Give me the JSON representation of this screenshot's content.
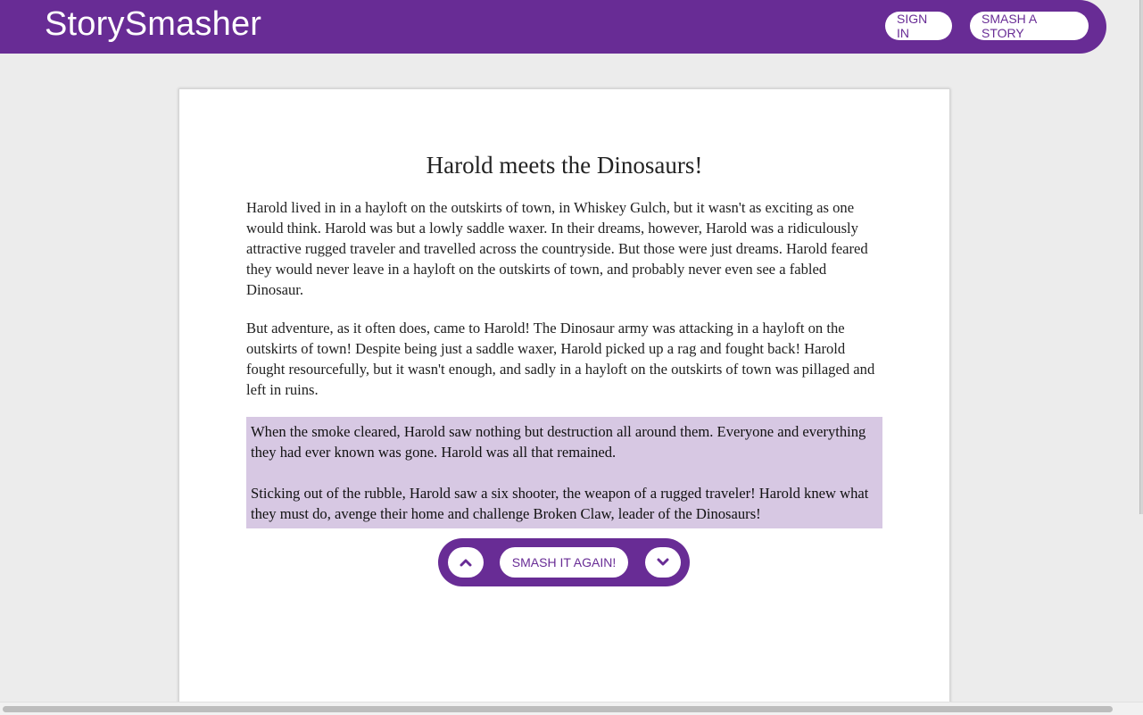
{
  "header": {
    "brand": "StorySmasher",
    "sign_in_label": "SIGN IN",
    "smash_story_label": "SMASH A STORY"
  },
  "story": {
    "title": "Harold meets the Dinosaurs!",
    "paragraphs": [
      "Harold lived in in a hayloft on the outskirts of town, in Whiskey Gulch, but it wasn't as exciting as one would think. Harold was but a lowly saddle waxer. In their dreams, however, Harold was a ridiculously attractive rugged traveler and travelled across the countryside. But those were just dreams. Harold feared they would never leave in a hayloft on the outskirts of town, and probably never even see a fabled Dinosaur.",
      "But adventure, as it often does, came to Harold! The Dinosaur army was attacking in a hayloft on the outskirts of town! Despite being just a saddle waxer, Harold picked up a rag and fought back! Harold fought resourcefully, but it wasn't enough, and sadly in a hayloft on the outskirts of town was pillaged and left in ruins."
    ],
    "highlighted": [
      "When the smoke cleared, Harold saw nothing but destruction all around them. Everyone and everything they had ever known was gone. Harold was all that remained.",
      "Sticking out of the rubble, Harold saw a six shooter, the weapon of a rugged traveler! Harold knew what they must do, avenge their home and challenge Broken Claw, leader of the Dinosaurs!"
    ]
  },
  "controls": {
    "smash_again_label": "SMASH IT AGAIN!",
    "up_icon": "chevron-up-icon",
    "down_icon": "chevron-down-icon"
  },
  "colors": {
    "brand_purple": "#682c95",
    "highlight": "#d7c8e3",
    "background": "#ececec"
  }
}
